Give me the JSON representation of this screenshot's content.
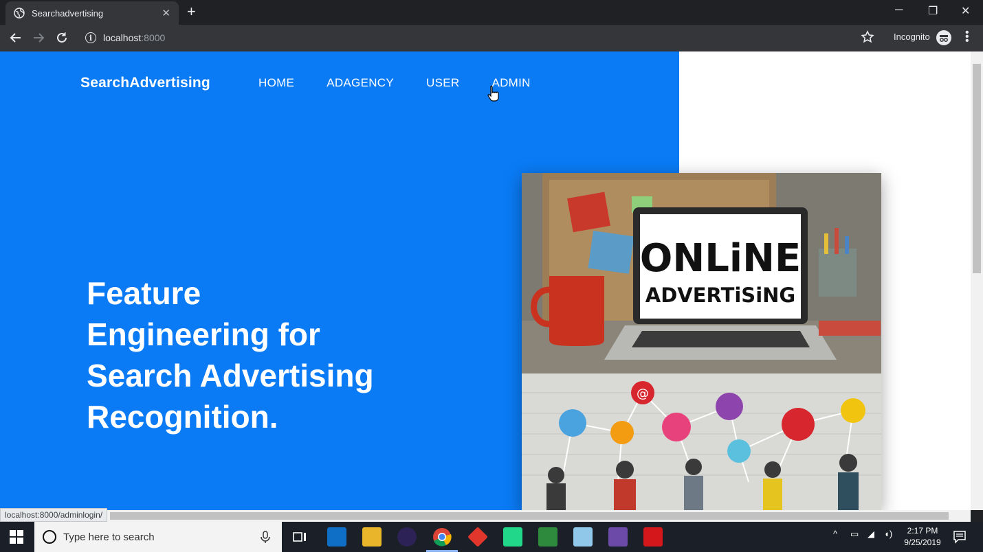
{
  "browser": {
    "tab_title": "Searchadvertising",
    "tab_close": "✕",
    "new_tab": "+",
    "url_host": "localhost",
    "url_port": ":8000",
    "incognito_label": "Incognito",
    "status_url": "localhost:8000/adminlogin/"
  },
  "page": {
    "brand": "SearchAdvertising",
    "nav": [
      "HOME",
      "ADAGENCY",
      "USER",
      "ADMIN"
    ],
    "headline": "Feature Engineering for Search Advertising Recognition.",
    "hero_image": {
      "screen_text_line1": "ONLiNE",
      "screen_text_line2": "ADVERTiSiNG"
    }
  },
  "taskbar": {
    "search_placeholder": "Type here to search",
    "time": "2:17 PM",
    "date": "9/25/2019"
  },
  "colors": {
    "brand_blue": "#0a7bf5",
    "chrome_dark": "#202124",
    "chrome_toolbar": "#35363a"
  }
}
